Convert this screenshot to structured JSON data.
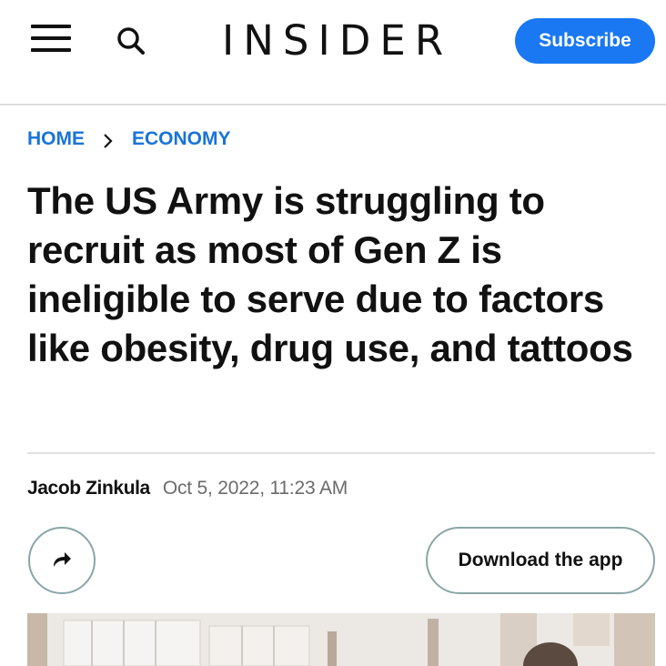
{
  "header": {
    "logo": "INSIDER",
    "subscribe_label": "Subscribe",
    "menu_icon": "hamburger-menu-icon",
    "search_icon": "search-icon"
  },
  "breadcrumb": {
    "items": [
      {
        "label": "HOME"
      },
      {
        "label": "ECONOMY"
      }
    ],
    "separator_icon": "chevron-right-icon"
  },
  "article": {
    "headline": "The US Army is struggling to recruit as most of Gen Z is ineligible to serve due to factors like obesity, drug use, and tattoos",
    "author": "Jacob Zinkula",
    "date": "Oct 5, 2022, 11:23 AM"
  },
  "actions": {
    "share_icon": "share-arrow-icon",
    "download_label": "Download the app"
  },
  "colors": {
    "accent": "#1978f2",
    "link": "#1a73d8",
    "text": "#111111",
    "muted": "#6b6b6b",
    "button_border": "#8aa6a6"
  }
}
